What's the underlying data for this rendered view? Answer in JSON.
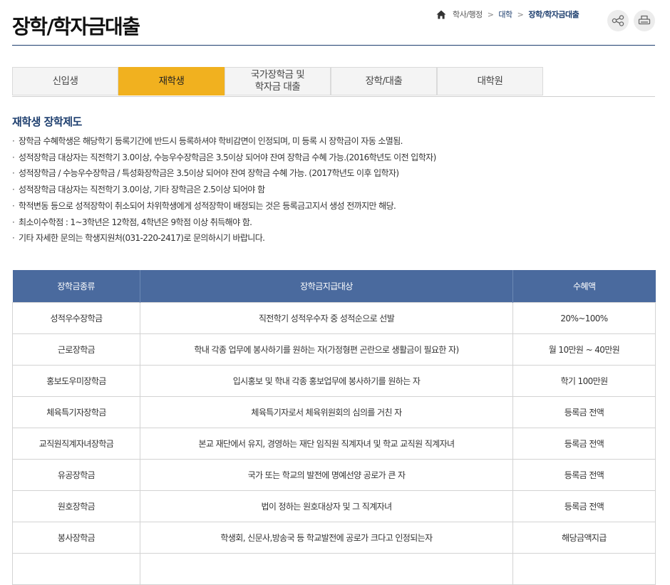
{
  "header": {
    "title": "장학/학자금대출",
    "breadcrumb": [
      "학사/행정",
      "대학",
      "장학/학자금대출"
    ]
  },
  "tabs": [
    {
      "label": "신입생",
      "active": false
    },
    {
      "label": "재학생",
      "active": true
    },
    {
      "label": "국가장학금 및\n학자금 대출",
      "active": false
    },
    {
      "label": "장학/대출",
      "active": false
    },
    {
      "label": "대학원",
      "active": false
    }
  ],
  "section": {
    "title": "재학생 장학제도",
    "notes": [
      "장학금 수혜학생은 해당학기 등록기간에 반드시 등록하셔야 학비감면이 인정되며, 미 등록 시 장학금이 자동 소멸됨.",
      "성적장학금 대상자는 직전학기 3.0이상, 수능우수장학금은 3.5이상 되어야 잔여 장학금 수혜 가능.(2016학년도 이전 입학자)",
      "성적장학금 / 수능우수장학금 / 특성화장학금은 3.5이상 되어야 잔여 장학금 수혜 가능. (2017학년도 이후 입학자)",
      "성적장학금 대상자는 직전학기 3.0이상, 기타 장학금은 2.5이상 되어야 함",
      "학적변동 등으로 성적장학이 취소되어 차위학생에게 성적장학이 배정되는 것은 등록금고지서 생성 전까지만 해당.",
      "최소이수학점 : 1~3학년은 12학점, 4학년은 9학점 이상 취득해야 함.",
      "기타 자세한 문의는 학생지원처(031-220-2417)로 문의하시기 바랍니다."
    ]
  },
  "table": {
    "headers": [
      "장학금종류",
      "장학금지급대상",
      "수혜액"
    ],
    "rows": [
      [
        "성적우수장학금",
        "직전학기 성적우수자 중 성적순으로 선발",
        "20%~100%"
      ],
      [
        "근로장학금",
        "학내 각종 업무에 봉사하기를 원하는 자(가정형편 곤란으로 생활금이 필요한 자)",
        "월 10만원 ~ 40만원"
      ],
      [
        "홍보도우미장학금",
        "입시홍보 및 학내 각종 홍보업무에 봉사하기를 원하는 자",
        "학기 100만원"
      ],
      [
        "체육특기자장학금",
        "체육특기자로서 체육위원회의 심의를 거친 자",
        "등록금 전액"
      ],
      [
        "교직원직계자녀장학금",
        "본교 재단에서 유지, 경영하는 재단 임직원 직계자녀 및 학교 교직원 직계자녀",
        "등록금 전액"
      ],
      [
        "유공장학금",
        "국가 또는 학교의 발전에 명예선양 공로가 큰 자",
        "등록금 전액"
      ],
      [
        "원호장학금",
        "법이 정하는 원호대상자 및 그 직계자녀",
        "등록금 전액"
      ],
      [
        "봉사장학금",
        "학생회, 신문사,방송국 등 학교발전에 공로가 크다고 인정되는자",
        "해당금액지급"
      ],
      [
        "",
        "",
        ""
      ]
    ]
  },
  "colors": {
    "active_tab": "#f1b11f",
    "table_header": "#4a6a9e",
    "accent_navy": "#1d3e6e"
  },
  "icons": [
    "home-icon",
    "share-icon",
    "print-icon"
  ]
}
